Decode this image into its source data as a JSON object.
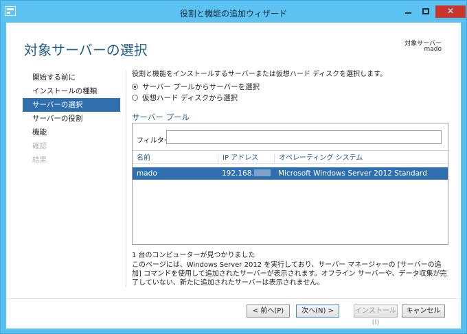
{
  "window": {
    "title": "役割と機能の追加ウィザード",
    "minimize_glyph": "",
    "close_glyph": "✕"
  },
  "header": {
    "page_title": "対象サーバーの選択",
    "destination_label": "対象サーバー",
    "destination_server": "mado"
  },
  "nav": {
    "items": [
      {
        "label": "開始する前に",
        "state": "normal"
      },
      {
        "label": "インストールの種類",
        "state": "normal"
      },
      {
        "label": "サーバーの選択",
        "state": "active"
      },
      {
        "label": "サーバーの役割",
        "state": "normal"
      },
      {
        "label": "機能",
        "state": "normal"
      },
      {
        "label": "確認",
        "state": "disabled"
      },
      {
        "label": "結果",
        "state": "disabled"
      }
    ]
  },
  "content": {
    "instruction": "役割と機能をインストールするサーバーまたは仮想ハード ディスクを選択します。",
    "options": [
      {
        "label": "サーバー プールからサーバーを選択",
        "checked": true
      },
      {
        "label": "仮想ハード ディスクから選択",
        "checked": false
      }
    ],
    "pool_title": "サーバー プール",
    "filter_label": "フィルター:",
    "filter_value": "",
    "columns": [
      "名前",
      "IP アドレス",
      "オペレーティング システム"
    ],
    "rows": [
      {
        "name": "mado",
        "ip": "192.168.",
        "os": "Microsoft Windows Server 2012 Standard"
      }
    ],
    "count_text": "1 台のコンピューターが見つかりました",
    "description": "このページには、Windows Server 2012 を実行しており、サーバー マネージャーの [サーバーの追加] コマンドを使用して追加されたサーバーが表示されます。オフライン サーバーや、データ収集が完了していない、新たに追加されたサーバーは表示されません。"
  },
  "buttons": {
    "prev": "< 前へ(P)",
    "next": "次へ(N) >",
    "install": "インストール(I)",
    "cancel": "キャンセル"
  },
  "colors": {
    "titlebar": "#5bc2f2",
    "accent": "#2f6fb0",
    "close": "#c7372f",
    "heading": "#1d5a8a"
  }
}
